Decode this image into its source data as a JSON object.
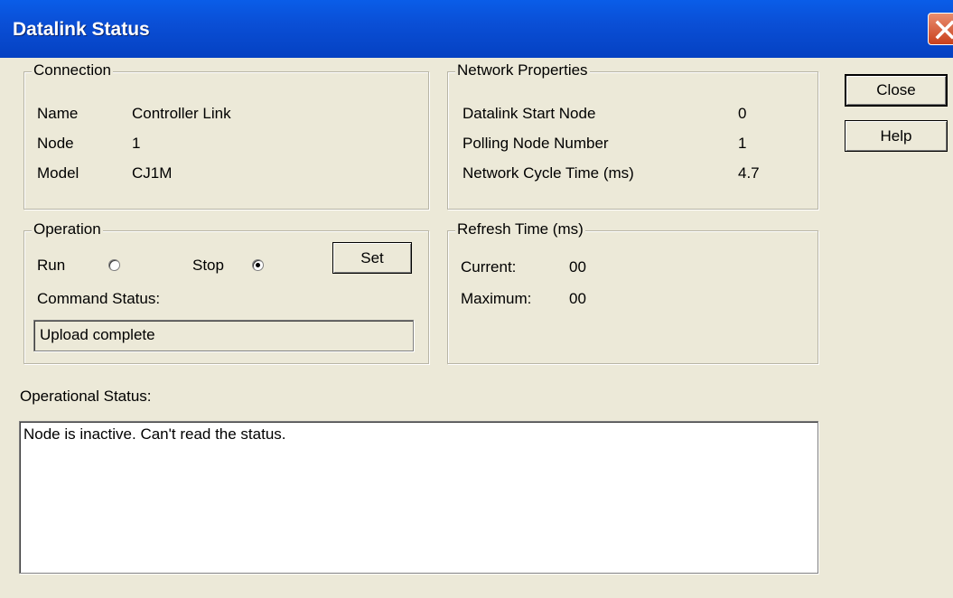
{
  "window": {
    "title": "Datalink Status"
  },
  "connection": {
    "legend": "Connection",
    "rows": [
      {
        "label": "Name",
        "value": "Controller Link"
      },
      {
        "label": "Node",
        "value": "1"
      },
      {
        "label": "Model",
        "value": "CJ1M"
      }
    ]
  },
  "network": {
    "legend": "Network Properties",
    "rows": [
      {
        "label": "Datalink Start Node",
        "value": "0"
      },
      {
        "label": "Polling Node Number",
        "value": "1"
      },
      {
        "label": "Network Cycle Time (ms)",
        "value": "4.7"
      }
    ]
  },
  "operation": {
    "legend": "Operation",
    "run_label": "Run",
    "stop_label": "Stop",
    "selected": "Stop",
    "set_label": "Set",
    "command_status_label": "Command Status:",
    "command_status_value": "Upload complete"
  },
  "refresh": {
    "legend": "Refresh Time (ms)",
    "current_label": "Current:",
    "current_value": "00",
    "maximum_label": "Maximum:",
    "maximum_value": "00"
  },
  "buttons": {
    "close_label": "Close",
    "help_label": "Help"
  },
  "operational_status": {
    "label": "Operational Status:",
    "text": "Node is inactive. Can't read the status."
  }
}
